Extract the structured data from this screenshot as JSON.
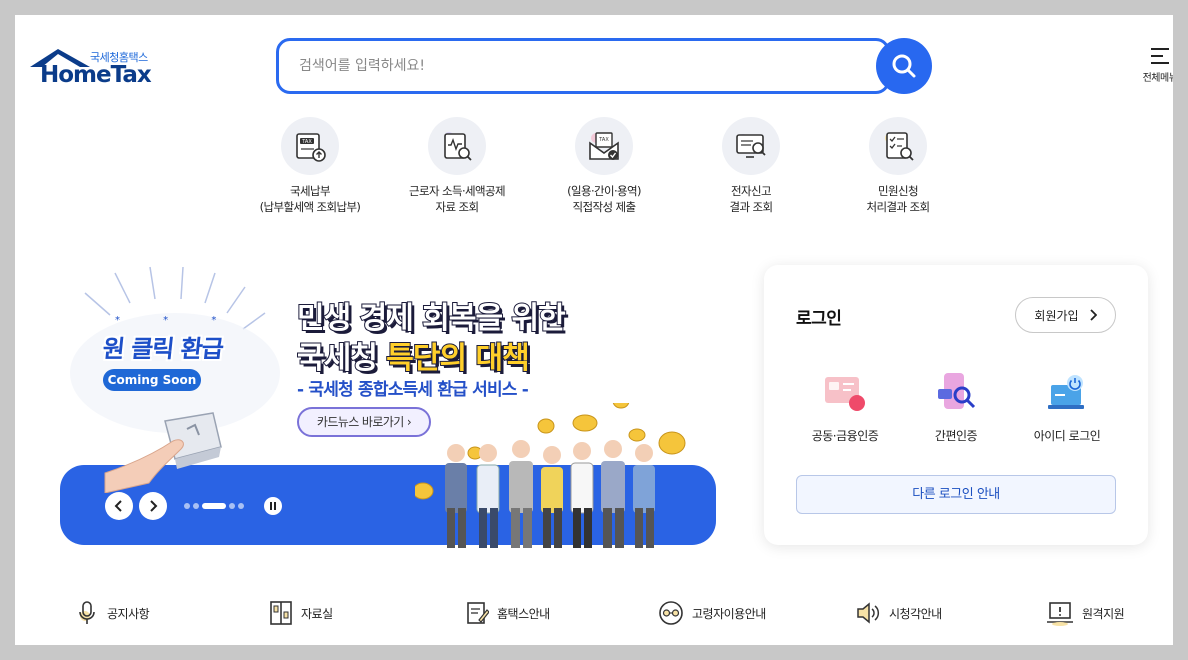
{
  "header": {
    "logo_sub": "국세청홈택스",
    "logo_main": "HomeTax",
    "search_placeholder": "검색어를 입력하세요!",
    "menu_label": "전체메뉴"
  },
  "quick_menu": [
    {
      "line1": "국세납부",
      "line2": "(납부할세액 조회납부)",
      "icon": "tax-payment-icon"
    },
    {
      "line1": "근로자 소득·세액공제",
      "line2": "자료 조회",
      "icon": "income-deduction-icon"
    },
    {
      "line1": "(일용·간이·용역)",
      "line2": "직접작성 제출",
      "icon": "tax-submit-icon"
    },
    {
      "line1": "전자신고",
      "line2": "결과 조회",
      "icon": "e-filing-result-icon"
    },
    {
      "line1": "민원신청",
      "line2": "처리결과 조회",
      "icon": "civil-request-icon"
    }
  ],
  "banner": {
    "oneclick": "원 클릭 환급",
    "stars": "* * *",
    "coming_soon": "Coming Soon",
    "headline1": "민생 경제 회복을 위한",
    "headline2_a": "국세청 ",
    "headline2_b": "특단의 대책",
    "subline": "- 국세청 종합소득세 환급 서비스 -",
    "cardnews": "카드뉴스 바로가기",
    "slide_count": 5,
    "active_slide": 3
  },
  "login": {
    "title": "로그인",
    "join": "회원가입",
    "methods": [
      {
        "label": "공동·금융인증",
        "icon": "certificate-icon"
      },
      {
        "label": "간편인증",
        "icon": "simple-auth-icon"
      },
      {
        "label": "아이디 로그인",
        "icon": "id-login-icon"
      }
    ],
    "other": "다른 로그인 안내"
  },
  "bottom_links": [
    {
      "label": "공지사항",
      "icon": "microphone-icon"
    },
    {
      "label": "자료실",
      "icon": "archive-icon"
    },
    {
      "label": "홈택스안내",
      "icon": "guide-icon"
    },
    {
      "label": "고령자이용안내",
      "icon": "senior-icon"
    },
    {
      "label": "시청각안내",
      "icon": "speaker-icon"
    },
    {
      "label": "원격지원",
      "icon": "remote-support-icon"
    }
  ],
  "colors": {
    "primary": "#2868f0",
    "banner_blue": "#2a63e4",
    "navy": "#0b3c8a",
    "yellow": "#ffcf2a"
  }
}
